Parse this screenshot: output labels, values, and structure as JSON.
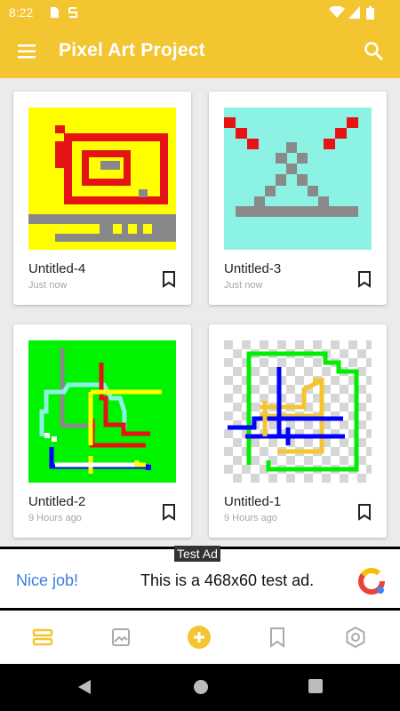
{
  "status_bar": {
    "time": "8:22"
  },
  "app_bar": {
    "title": "Pixel Art Project"
  },
  "projects": [
    {
      "name": "Untitled-4",
      "time": "Just now"
    },
    {
      "name": "Untitled-3",
      "time": "Just now"
    },
    {
      "name": "Untitled-2",
      "time": "9 Hours ago"
    },
    {
      "name": "Untitled-1",
      "time": "9 Hours ago"
    }
  ],
  "ad": {
    "badge": "Test Ad",
    "headline": "Nice job!",
    "text": "This is a 468x60 test ad."
  },
  "bottom_nav": [
    "projects-icon",
    "gallery-icon",
    "add-icon",
    "bookmarks-icon",
    "settings-icon"
  ],
  "colors": {
    "accent": "#f3c531",
    "ad_link": "#3b7de0"
  }
}
